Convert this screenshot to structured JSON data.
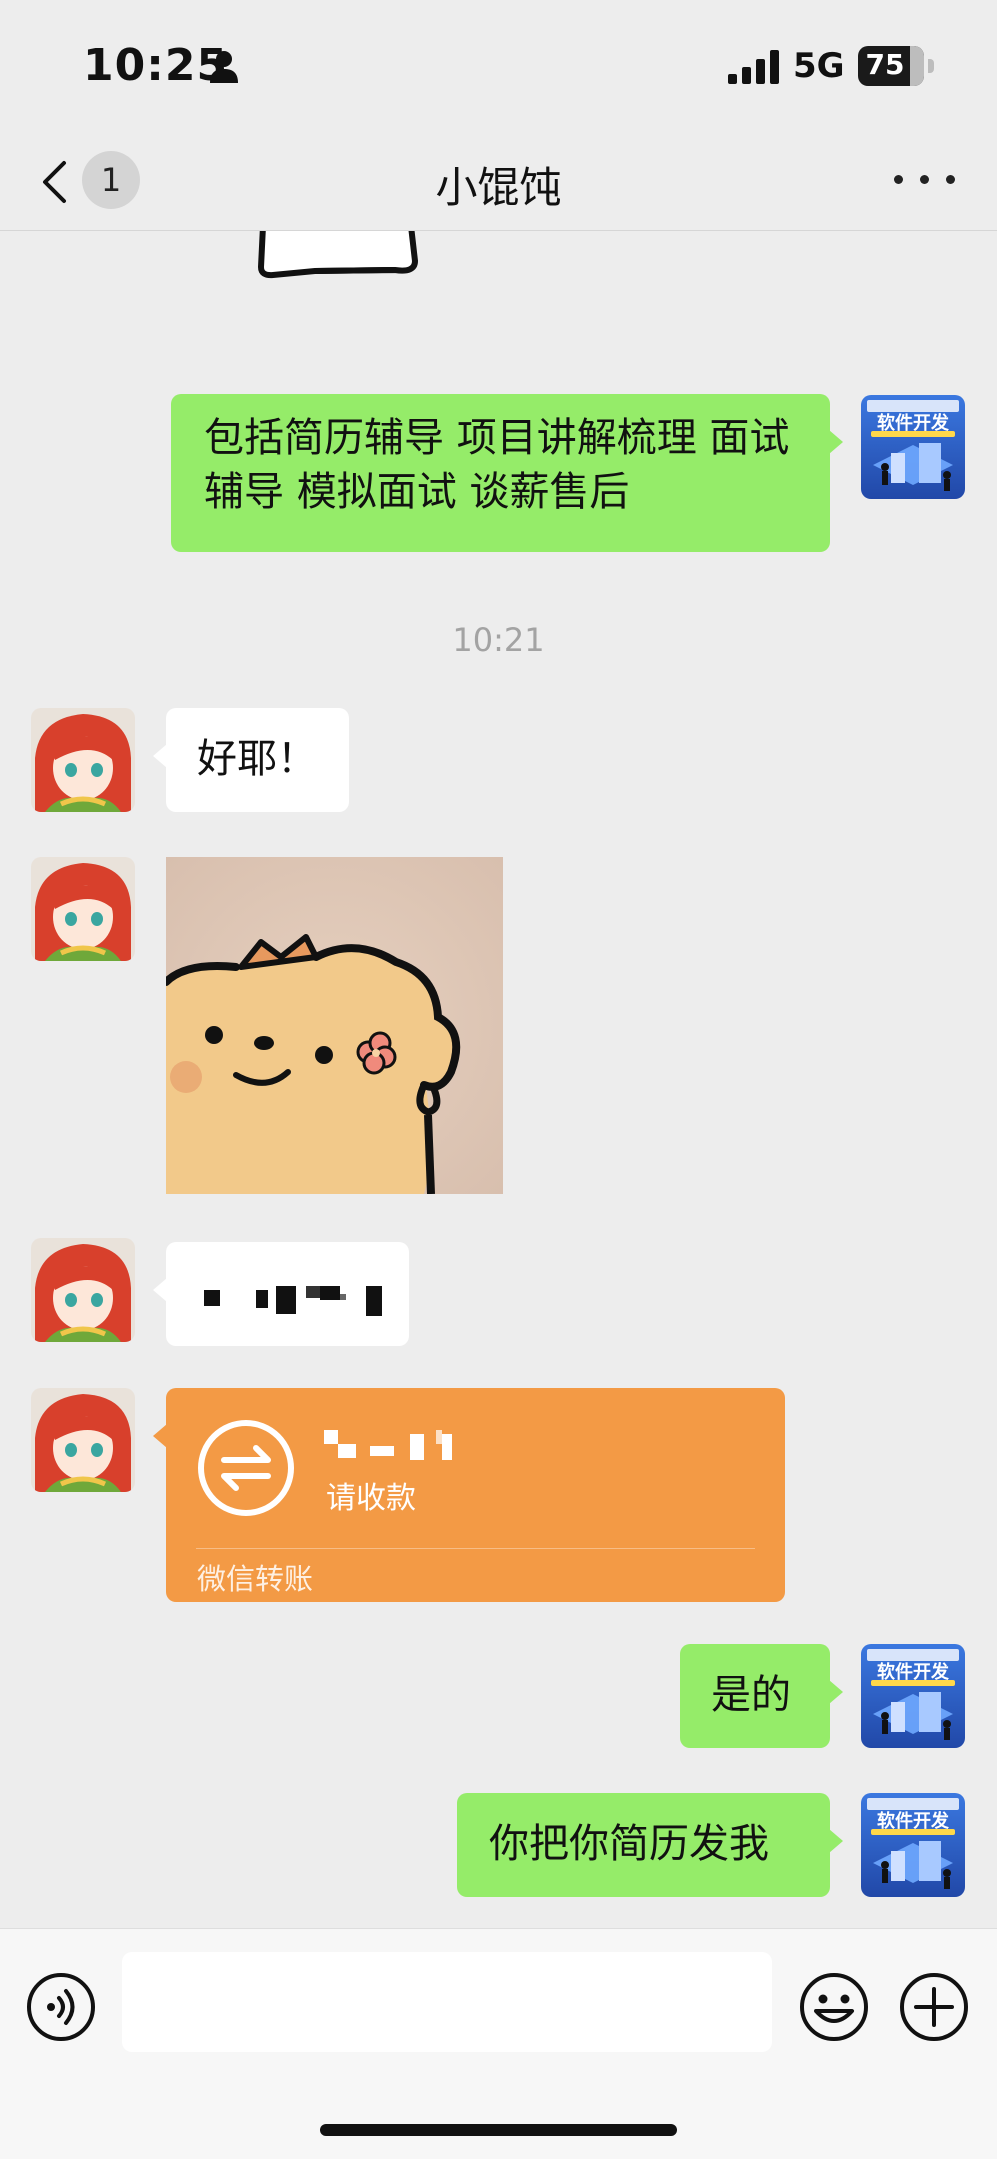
{
  "status_bar": {
    "time": "10:25",
    "network": "5G",
    "battery": "75"
  },
  "header": {
    "back_badge": "1",
    "title": "小馄饨"
  },
  "chat": {
    "msg_services": "包括简历辅导 项目讲解梳理 面试辅导 模拟面试 谈薪售后",
    "timestamp": "10:21",
    "msg_haoye": "好耶！",
    "transfer": {
      "status": "请收款",
      "footer": "微信转账"
    },
    "msg_shide": "是的",
    "msg_resume": "你把你简历发我"
  },
  "my_avatar": {
    "title_text": "软件开发"
  },
  "colors": {
    "background": "#ededed",
    "my_bubble": "#95ec69",
    "other_bubble": "#ffffff",
    "transfer": "#f39a45"
  },
  "icons": [
    "back-arrow-icon",
    "person-icon",
    "signal-icon",
    "more-dots-icon",
    "voice-icon",
    "emoji-icon",
    "plus-icon",
    "transfer-arrows-icon"
  ]
}
